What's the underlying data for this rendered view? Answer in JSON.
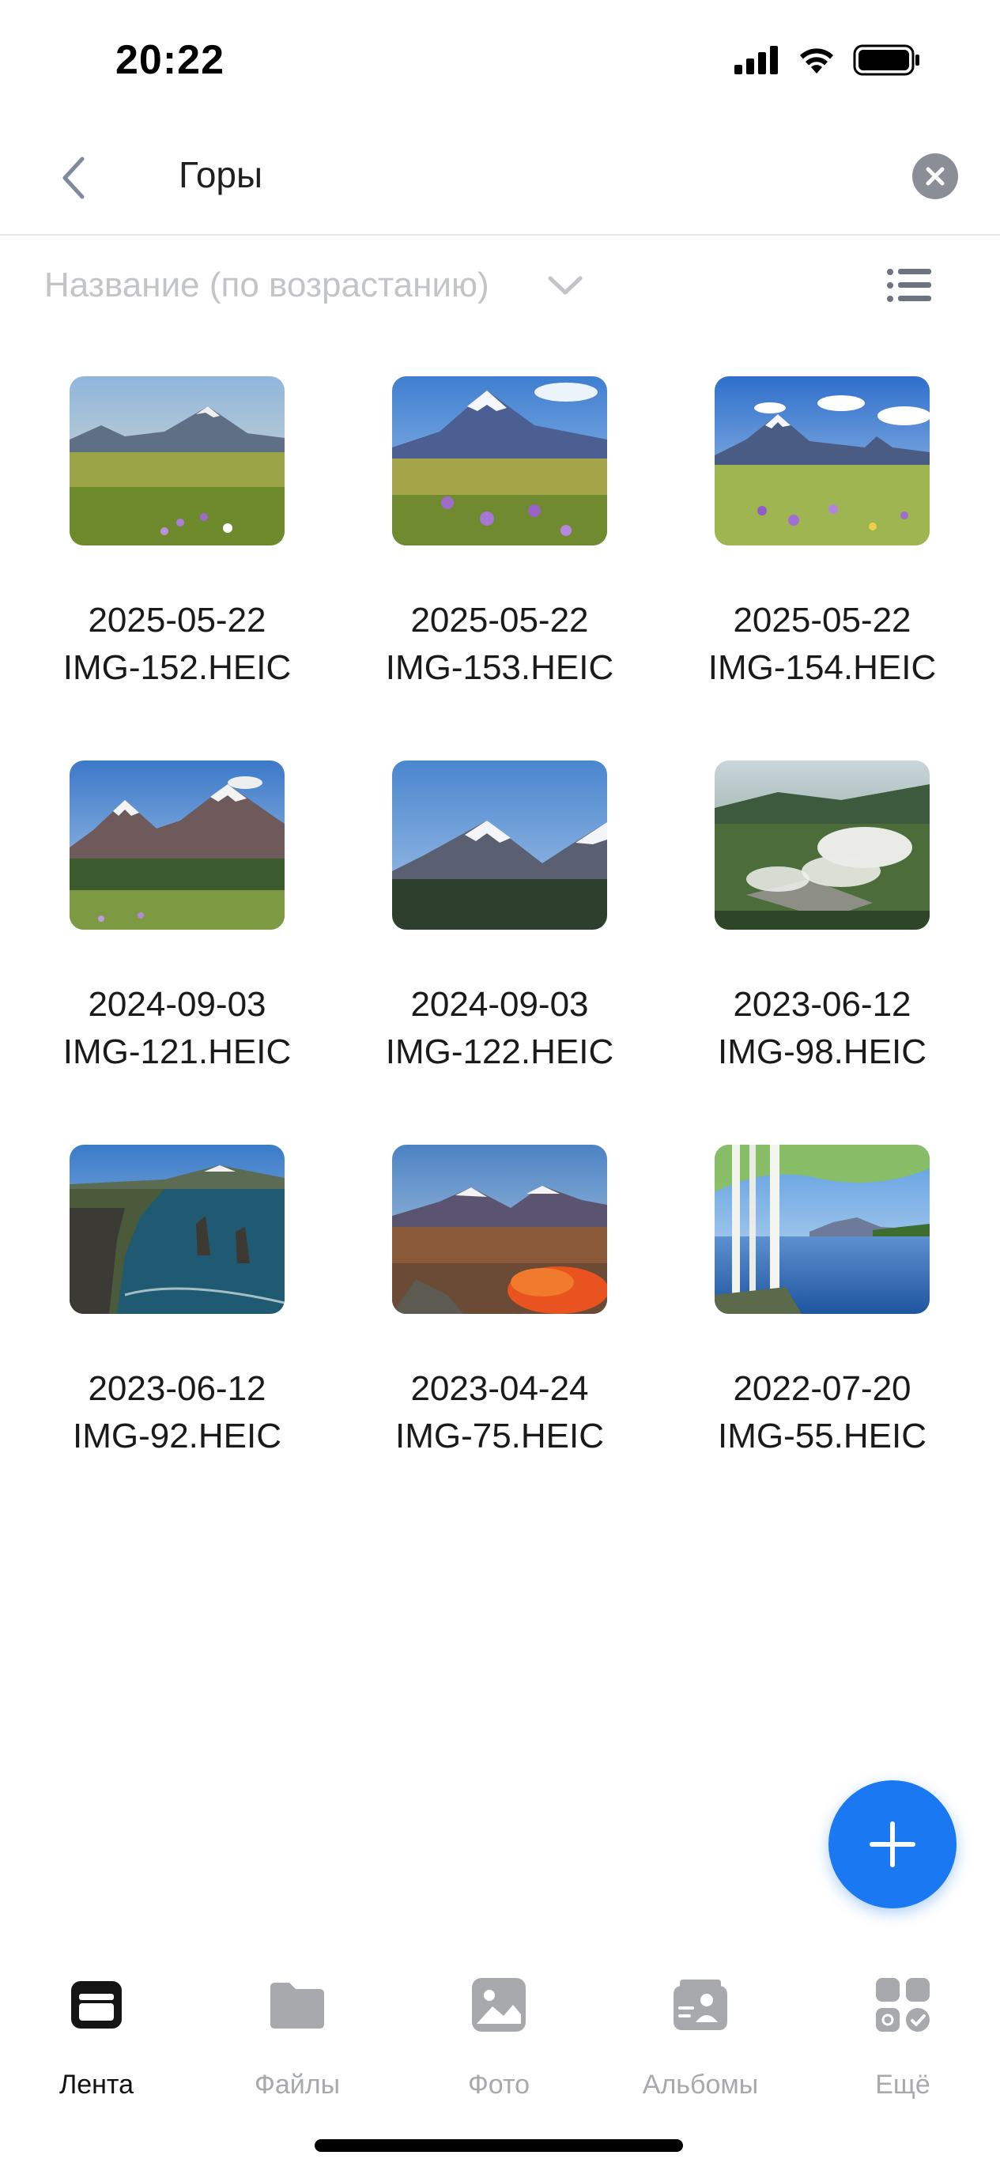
{
  "status_bar": {
    "time": "20:22"
  },
  "search": {
    "query": "Горы"
  },
  "sort": {
    "label": "Название (по возрастанию)"
  },
  "items": [
    {
      "date": "2025-05-22",
      "name": "IMG-152.HEIC",
      "scene": "meadow-volcano"
    },
    {
      "date": "2025-05-22",
      "name": "IMG-153.HEIC",
      "scene": "meadow-volcano"
    },
    {
      "date": "2025-05-22",
      "name": "IMG-154.HEIC",
      "scene": "meadow-volcano"
    },
    {
      "date": "2024-09-03",
      "name": "IMG-121.HEIC",
      "scene": "twin-volcanoes"
    },
    {
      "date": "2024-09-03",
      "name": "IMG-122.HEIC",
      "scene": "snow-peaks"
    },
    {
      "date": "2023-06-12",
      "name": "IMG-98.HEIC",
      "scene": "geysers"
    },
    {
      "date": "2023-06-12",
      "name": "IMG-92.HEIC",
      "scene": "sea-cliffs"
    },
    {
      "date": "2023-04-24",
      "name": "IMG-75.HEIC",
      "scene": "autumn-volcano"
    },
    {
      "date": "2022-07-20",
      "name": "IMG-55.HEIC",
      "scene": "birch-lake"
    }
  ],
  "tabs": [
    {
      "label": "Лента",
      "icon": "feed-icon",
      "active": true
    },
    {
      "label": "Файлы",
      "icon": "folder-icon",
      "active": false
    },
    {
      "label": "Фото",
      "icon": "photo-icon",
      "active": false
    },
    {
      "label": "Альбомы",
      "icon": "albums-icon",
      "active": false
    },
    {
      "label": "Ещё",
      "icon": "more-icon",
      "active": false
    }
  ],
  "colors": {
    "accent": "#1a78f2",
    "inactive_tab": "#a7a9ad",
    "sort_text": "#c2c4c8"
  }
}
